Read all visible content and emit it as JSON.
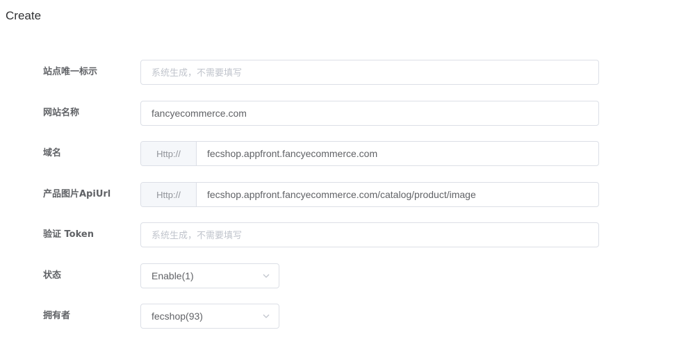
{
  "page": {
    "title": "Create"
  },
  "form": {
    "site_uid": {
      "label": "站点唯一标示",
      "value": "",
      "placeholder": "系统生成，不需要填写"
    },
    "site_name": {
      "label": "网站名称",
      "value": "fancyecommerce.com",
      "placeholder": ""
    },
    "domain": {
      "label": "域名",
      "prefix": "Http://",
      "value": "fecshop.appfront.fancyecommerce.com"
    },
    "image_api_url": {
      "label": "产品图片ApiUrl",
      "prefix": "Http://",
      "value": "fecshop.appfront.fancyecommerce.com/catalog/product/image"
    },
    "verify_token": {
      "label": "验证 Token",
      "value": "",
      "placeholder": "系统生成，不需要填写"
    },
    "status": {
      "label": "状态",
      "selected": "Enable(1)",
      "icon": "chevron-down-icon"
    },
    "owner": {
      "label": "拥有者",
      "selected": "fecshop(93)",
      "icon": "chevron-down-icon"
    }
  },
  "colors": {
    "border": "#dcdfe6",
    "label": "#606266",
    "placeholder": "#c0c4cc",
    "prepend_bg": "#f5f7fa"
  }
}
